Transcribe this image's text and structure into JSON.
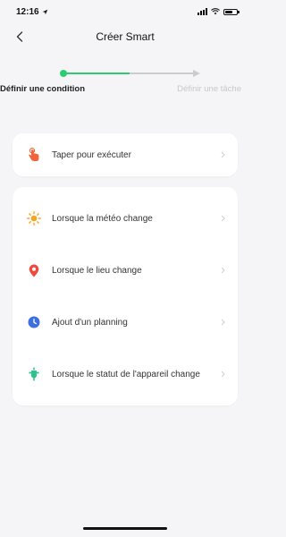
{
  "status_bar": {
    "time": "12:16",
    "location_icon": "location-arrow-icon",
    "signal_icon": "cellular-signal-icon",
    "wifi_icon": "wifi-icon",
    "battery_icon": "battery-icon",
    "battery_level": 0.7
  },
  "nav": {
    "back_icon": "chevron-left-icon",
    "title": "Créer Smart"
  },
  "stepper": {
    "current_step": 1,
    "steps": [
      {
        "label": "Définir une condition",
        "active": true
      },
      {
        "label": "Définir une tâche",
        "active": false
      }
    ],
    "colors": {
      "active": "#2ecc71",
      "inactive": "#cccccc"
    }
  },
  "primary_actions": [
    {
      "label": "Taper pour exécuter",
      "icon": "tap-hand-icon",
      "color": "#f2643b"
    }
  ],
  "conditions": [
    {
      "label": "Lorsque la météo change",
      "icon": "sun-icon",
      "color": "#f7a520"
    },
    {
      "label": "Lorsque le lieu change",
      "icon": "location-pin-icon",
      "color": "#f04a3e"
    },
    {
      "label": "Ajout d'un planning",
      "icon": "clock-icon",
      "color": "#3d6fe3"
    },
    {
      "label": "Lorsque le statut de l'appareil change",
      "icon": "device-icon",
      "color": "#2fc48a"
    }
  ],
  "chevron_icon": "chevron-right-icon"
}
